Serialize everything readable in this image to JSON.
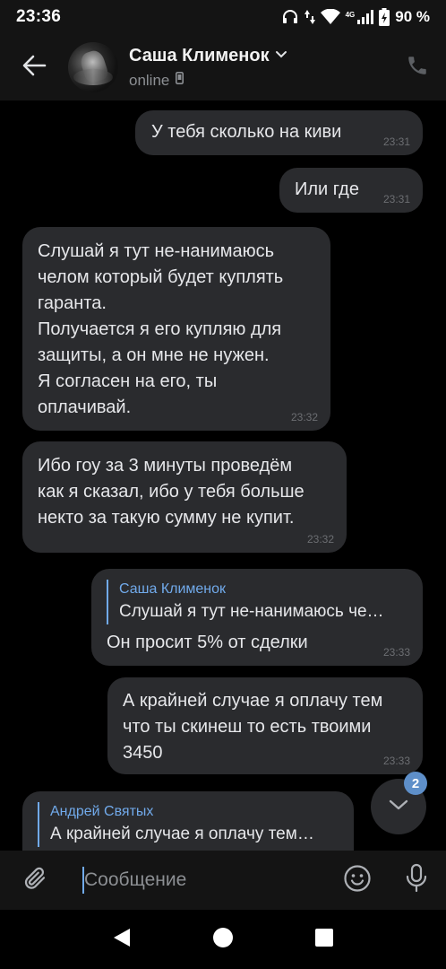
{
  "status_bar": {
    "time": "23:36",
    "network": "4G",
    "battery": "90 %"
  },
  "header": {
    "contact_name": "Саша Клименок",
    "status": "online"
  },
  "messages": [
    {
      "side": "out",
      "text": "У тебя сколько на киви",
      "time": "23:31"
    },
    {
      "side": "out",
      "text": "Или где",
      "time": "23:31"
    },
    {
      "side": "in",
      "text": "Слушай я тут не-нанимаюсь\nчелом который будет куплять\nгаранта.\nПолучается я его купляю для\nзащиты, а он мне не нужен.\nЯ согласен на его, ты\nоплачивай.",
      "time": "23:32"
    },
    {
      "side": "in",
      "text": "Ибо гоу за 3 минуты проведём\nкак я сказал, ибо у тебя больше\nнекто за такую сумму не купит.",
      "time": "23:32"
    },
    {
      "side": "out",
      "reply_name": "Саша Клименок",
      "reply_text": "Слушай я тут не-нанимаюсь че…",
      "text": "Он просит 5% от сделки",
      "time": "23:33"
    },
    {
      "side": "out",
      "text": "А крайней случае я оплачу тем\nчто ты скинеш то есть твоими\n3450",
      "time": "23:33"
    },
    {
      "side": "in",
      "reply_name": "Андрей Святых",
      "reply_text": "А крайней случае я оплачу тем…",
      "text": "",
      "time": ""
    }
  ],
  "scroll_down": {
    "unread_count": "2"
  },
  "composer": {
    "placeholder": "Сообщение"
  },
  "icons": {
    "back": "arrow-left-icon",
    "call": "phone-icon",
    "attach": "paperclip-icon",
    "emoji": "smiley-icon",
    "voice": "microphone-icon",
    "scroll_down": "chevron-down-icon"
  },
  "colors": {
    "accent": "#71aaeb",
    "bubble": "#2a2b2e",
    "header_bg": "#141414",
    "badge": "#5e8fc9"
  }
}
